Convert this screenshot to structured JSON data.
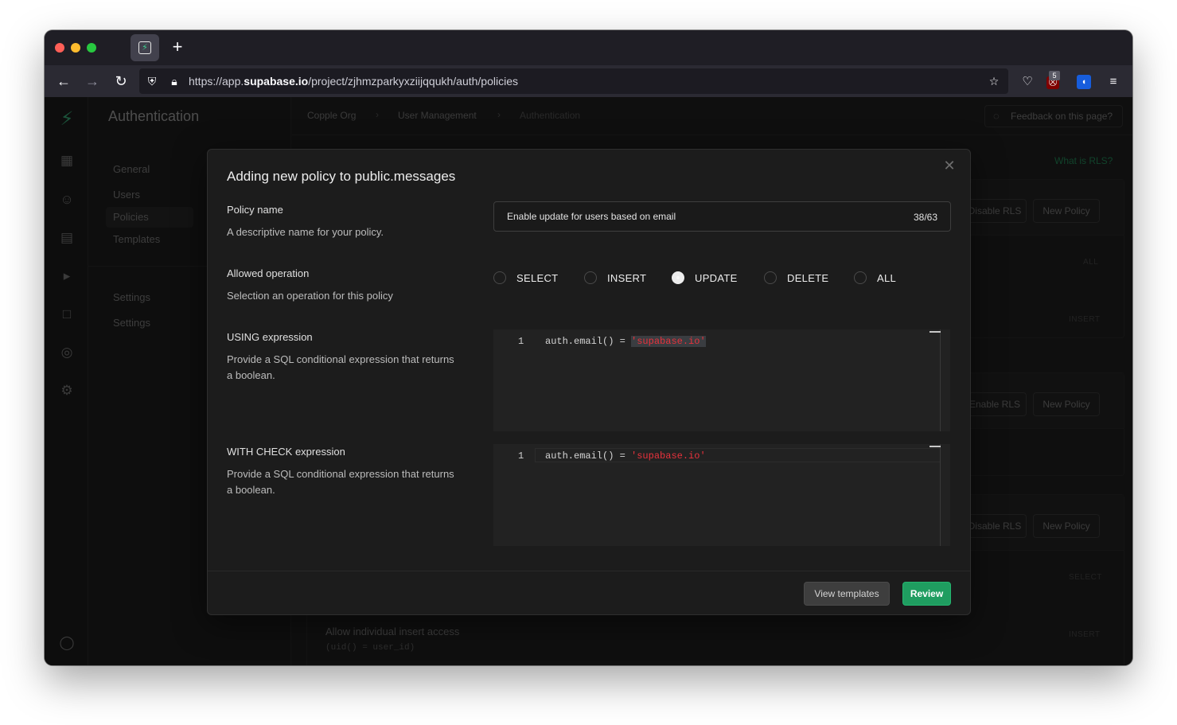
{
  "browser": {
    "tab_icon": "supabase-bolt-icon",
    "url_prefix": "https://app.",
    "url_domain": "supabase.io",
    "url_path": "/project/zjhmzparkyxziijqqukh/auth/policies",
    "extension_badge": "5"
  },
  "sidebar": {
    "title": "Authentication",
    "items": [
      {
        "label": "General"
      },
      {
        "label": "Users"
      },
      {
        "label": "Policies"
      },
      {
        "label": "Templates"
      },
      {
        "label": "Settings"
      },
      {
        "label": "Settings"
      }
    ]
  },
  "topbar": {
    "breadcrumb": [
      "Copple Org",
      "User Management",
      "Authentication"
    ],
    "feedback_label": "Feedback on this page?"
  },
  "background": {
    "rls_link": "What is RLS?",
    "panels": [
      {
        "rls_button": "Disable RLS",
        "new_policy": "New Policy",
        "tag": "ALL"
      },
      {
        "rls_button": "Enable RLS",
        "new_policy": "New Policy"
      },
      {
        "rls_button": "Disable RLS",
        "new_policy": "New Policy",
        "tag": "SELECT"
      }
    ],
    "tag_insert": "INSERT",
    "row_title": "Allow individual insert access",
    "row_sql": "(uid() = user_id)"
  },
  "modal": {
    "title": "Adding new policy to public.messages",
    "policy_name": {
      "label": "Policy name",
      "description": "A descriptive name for your policy.",
      "value": "Enable update for users based on email",
      "count": "38/63"
    },
    "operation": {
      "label": "Allowed operation",
      "description": "Selection an operation for this policy",
      "options": [
        {
          "label": "SELECT",
          "checked": false
        },
        {
          "label": "INSERT",
          "checked": false
        },
        {
          "label": "UPDATE",
          "checked": true
        },
        {
          "label": "DELETE",
          "checked": false
        },
        {
          "label": "ALL",
          "checked": false
        }
      ]
    },
    "using": {
      "label": "USING expression",
      "description": "Provide a SQL conditional expression that returns a boolean.",
      "line_number": "1",
      "code_prefix": "auth.email() = ",
      "code_string": "'supabase.io'"
    },
    "with_check": {
      "label": "WITH CHECK expression",
      "description": "Provide a SQL conditional expression that returns a boolean.",
      "line_number": "1",
      "code_prefix": "auth.email() = ",
      "code_string": "'supabase.io'"
    },
    "footer": {
      "view_templates": "View templates",
      "review": "Review"
    }
  },
  "colors": {
    "accent": "#3ecf8e",
    "primary_button": "#1f9d60",
    "sql_string": "#e8323c"
  }
}
